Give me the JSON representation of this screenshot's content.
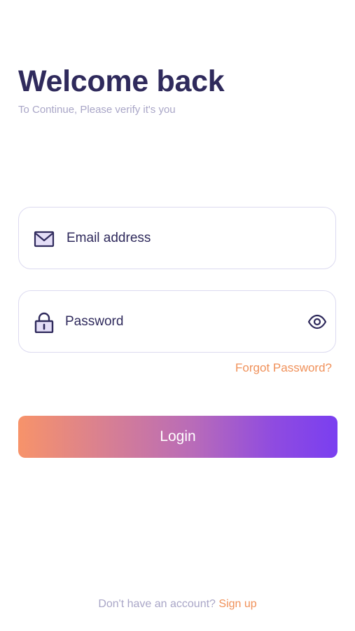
{
  "header": {
    "title": "Welcome back",
    "subtitle": "To Continue, Please verify it's you"
  },
  "form": {
    "email": {
      "placeholder": "Email address",
      "value": "",
      "icon": "mail-icon"
    },
    "password": {
      "placeholder": "Password",
      "value": "",
      "icon": "lock-icon",
      "toggle_icon": "eye-icon"
    },
    "forgot_label": "Forgot Password?",
    "login_label": "Login"
  },
  "footer": {
    "prompt": "Don't have an account?",
    "signup_label": "Sign up"
  },
  "colors": {
    "heading": "#2f2a5c",
    "muted": "#a9a6c7",
    "accent_orange": "#f0915a",
    "gradient_start": "#f7936a",
    "gradient_end": "#7a3ff0",
    "field_border": "#dcdaf0",
    "icon_fill": "#e4def7"
  }
}
